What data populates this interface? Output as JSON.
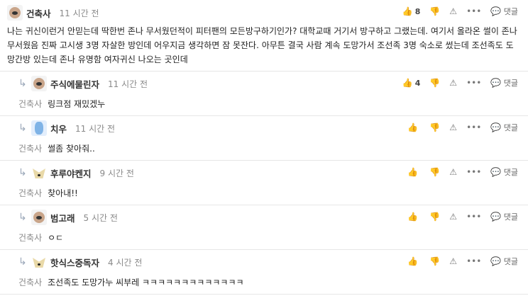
{
  "comments": [
    {
      "author": "건축사",
      "time": "11 시간 전",
      "likes": "8",
      "text": "나는 귀신이런거 안믿는데 딱한번 존나 무서웠던적이 피터팬의 모든방구하기인가? 대학교때 거기서 방구하고 그랬는데. 여기서 올라온 썰이 존나 무서웠음 진짜 고시생 3명 자살한 방인데 어우지금 생각하면 잠 못잔다. 아무튼 결국 사람 계속 도망가서 조선족 3명 숙소로 썼는데 조선족도 도망간방 있는데 존나 유명함 여자귀신 나오는 곳인데"
    },
    {
      "author": "주식에물린자",
      "time": "11 시간 전",
      "likes": "4",
      "mention": "건축사",
      "text": "링크점 재밌겠누"
    },
    {
      "author": "치우",
      "time": "11 시간 전",
      "likes": "",
      "mention": "건축사",
      "text": "썰좀 찾아줘.."
    },
    {
      "author": "후루야켄지",
      "time": "9 시간 전",
      "likes": "",
      "mention": "건축사",
      "text": "찾아내!!"
    },
    {
      "author": "범고래",
      "time": "5 시간 전",
      "likes": "",
      "mention": "건축사",
      "text": "ㅇㄷ"
    },
    {
      "author": "핫식스중독자",
      "time": "4 시간 전",
      "likes": "",
      "mention": "건축사",
      "text": "조선족도 도망가누 씨부레 ㅋㅋㅋㅋㅋㅋㅋㅋㅋㅋㅋㅋㅋ"
    }
  ],
  "labels": {
    "reply": "댓글"
  },
  "icons": {
    "like": "thumbs-up-icon",
    "dislike": "thumbs-down-icon",
    "report": "warning-icon",
    "more": "more-icon",
    "reply": "speech-bubble-icon",
    "reply_arrow": "reply-arrow-icon"
  }
}
